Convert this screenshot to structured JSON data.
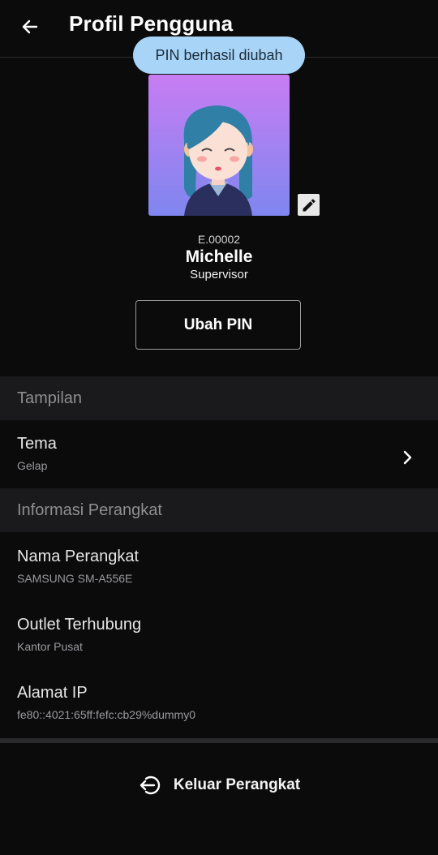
{
  "header": {
    "title": "Profil Pengguna"
  },
  "toast": {
    "message": "PIN berhasil diubah"
  },
  "profile": {
    "employee_id": "E.00002",
    "name": "Michelle",
    "role": "Supervisor",
    "change_pin_label": "Ubah PIN"
  },
  "sections": {
    "appearance": {
      "title": "Tampilan",
      "theme": {
        "label": "Tema",
        "value": "Gelap"
      }
    },
    "device": {
      "title": "Informasi Perangkat",
      "name": {
        "label": "Nama Perangkat",
        "value": "SAMSUNG SM-A556E"
      },
      "outlet": {
        "label": "Outlet Terhubung",
        "value": "Kantor Pusat"
      },
      "ip": {
        "label": "Alamat IP",
        "value": "fe80::4021:65ff:fefc:cb29%dummy0"
      }
    }
  },
  "logout": {
    "label": "Keluar Perangkat"
  },
  "icons": {
    "back": "arrow-left-icon",
    "edit": "pencil-icon",
    "chevron": "chevron-right-icon",
    "logout": "logout-icon"
  },
  "colors": {
    "background": "#0b0b0c",
    "section_bg": "#1a1a1c",
    "toast_bg": "#a8d4f7",
    "avatar_gradient_top": "#c77df2",
    "avatar_gradient_bottom": "#7f86f0"
  }
}
